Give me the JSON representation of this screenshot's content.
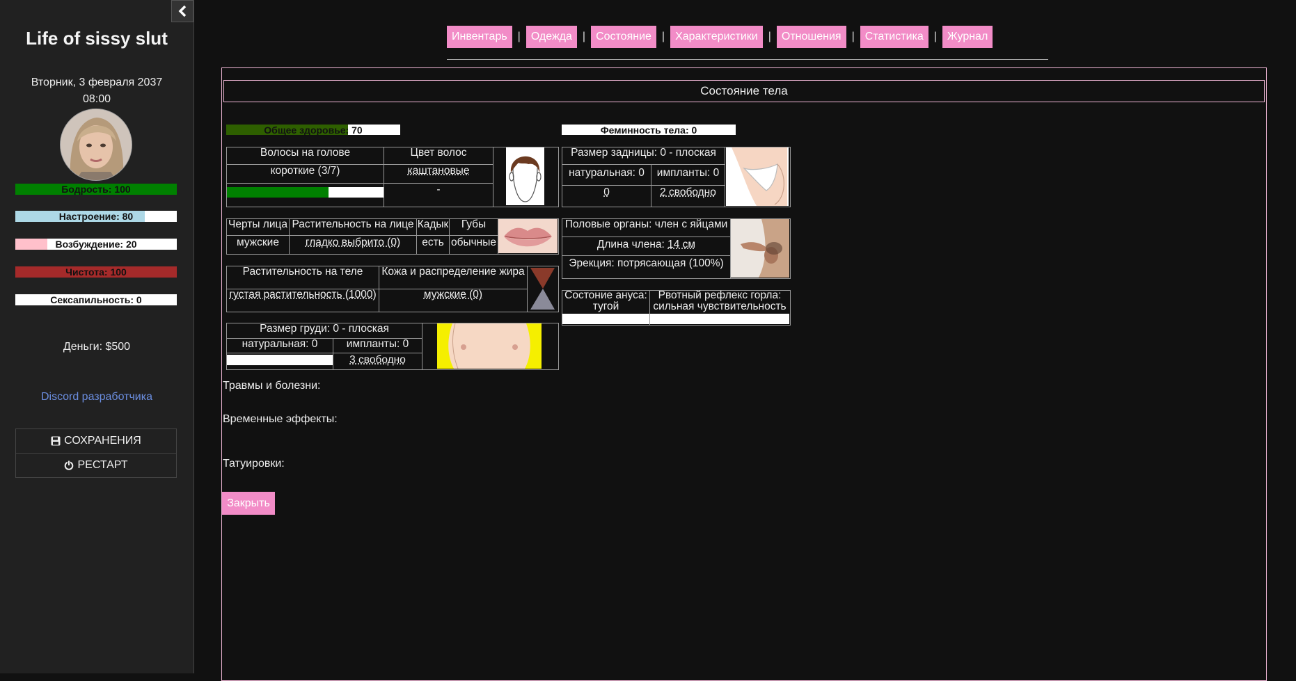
{
  "sidebar": {
    "title": "Life of sissy slut",
    "date": "Вторник, 3 февраля 2037",
    "time": "08:00",
    "stats": [
      {
        "label": "Бодрость: 100",
        "value": 100,
        "max": 100,
        "color": "#008000"
      },
      {
        "label": "Настроение: 80",
        "value": 80,
        "max": 100,
        "color": "#add8e6"
      },
      {
        "label": "Возбуждение: 20",
        "value": 20,
        "max": 100,
        "color": "#ffc0cb"
      },
      {
        "label": "Чистота: 100",
        "value": 100,
        "max": 100,
        "color": "#a52a2a"
      },
      {
        "label": "Сексапильность: 0",
        "value": 0,
        "max": 100,
        "color": "#f28cc7"
      }
    ],
    "money": "Деньги: $500",
    "discord": "Discord разработчика",
    "saves_label": "СОХРАНЕНИЯ",
    "restart_label": "РЕСТАРТ"
  },
  "tabs": [
    "Инвентарь",
    "Одежда",
    "Состояние",
    "Характеристики",
    "Отношения",
    "Статистика",
    "Журнал"
  ],
  "tab_separator": "|",
  "panel": {
    "title": "Состояние тела",
    "health": {
      "label": "Общее здоровье: 70",
      "value": 70,
      "max": 100,
      "color": "#2e5f00"
    },
    "femininity": {
      "label": "Феминность тела: 0",
      "value": 0,
      "max": 100
    },
    "hair": {
      "col1_header": "Волосы на голове",
      "col2_header": "Цвет волос",
      "length": "короткие (3/7)",
      "color": "каштановые",
      "extra": "-",
      "length_fill": 0.65,
      "bar_color": "#008000"
    },
    "face": {
      "h1": "Черты лица",
      "h2": "Растительность на лице",
      "h3": "Кадык",
      "h4": "Губы",
      "v1": "мужские",
      "v2": "гладко выбрито (0)",
      "v3": "есть",
      "v4": "обычные"
    },
    "body": {
      "h1": "Растительность на теле",
      "h2": "Кожа и распределение жира",
      "v1": "густая растительность (1000)",
      "v2": "мужские (0)"
    },
    "breast": {
      "header": "Размер груди: 0 - плоская",
      "natural": "натуральная: 0",
      "implants": "импланты: 0",
      "free": "3 свободно"
    },
    "butt": {
      "header": "Размер задницы: 0 - плоская",
      "natural": "натуральная: 0",
      "implants": "импланты: 0",
      "v0": "0",
      "free": "2 свободно"
    },
    "genitals": {
      "header": "Половые органы: член с яйцами",
      "length_label": "Длина члена: ",
      "length_value": "14 см",
      "erection": "Эрекция: потрясающая (100%)"
    },
    "anus": {
      "h1a": "Состоние ануса:",
      "h1b": "тугой",
      "h2a": "Рвотный рефлекс горла:",
      "h2b": "сильная чувствительность"
    },
    "injuries": "Травмы и болезни:",
    "effects": "Временные эффекты:",
    "tattoos": "Татуировки:",
    "close_label": "Закрыть"
  }
}
